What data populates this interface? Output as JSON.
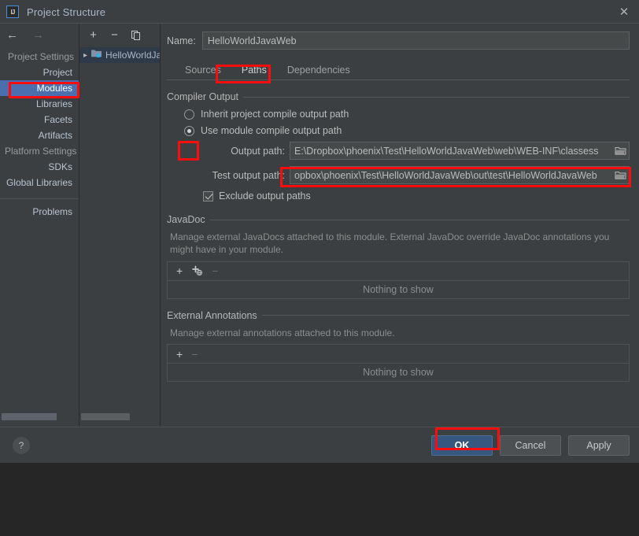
{
  "window": {
    "title": "Project Structure",
    "logo_text": "IJ",
    "close_icon": "close-icon"
  },
  "nav": {
    "back_icon": "arrow-left-icon",
    "forward_icon": "arrow-right-icon",
    "groups": [
      {
        "label": "Project Settings",
        "items": [
          {
            "label": "Project",
            "selected": false
          },
          {
            "label": "Modules",
            "selected": true
          },
          {
            "label": "Libraries",
            "selected": false
          },
          {
            "label": "Facets",
            "selected": false
          },
          {
            "label": "Artifacts",
            "selected": false
          }
        ]
      },
      {
        "label": "Platform Settings",
        "items": [
          {
            "label": "SDKs",
            "selected": false
          },
          {
            "label": "Global Libraries",
            "selected": false
          }
        ]
      }
    ],
    "problems_label": "Problems"
  },
  "tree": {
    "toolbar": {
      "add_icon": "plus-icon",
      "remove_icon": "minus-icon",
      "copy_icon": "copy-icon"
    },
    "nodes": [
      {
        "label": "HelloWorldJavaWeb",
        "expand_icon": "chevron-right-icon",
        "selected": true
      }
    ]
  },
  "main": {
    "name_label": "Name:",
    "name_value": "HelloWorldJavaWeb",
    "tabs": [
      {
        "label": "Sources",
        "active": false
      },
      {
        "label": "Paths",
        "active": true
      },
      {
        "label": "Dependencies",
        "active": false
      }
    ],
    "compiler_output": {
      "title": "Compiler Output",
      "inherit_option": "Inherit project compile output path",
      "module_option": "Use module compile output path",
      "inherit_selected": false,
      "module_selected": true,
      "output_path_label": "Output path:",
      "output_path_value": "E:\\Dropbox\\phoenix\\Test\\HelloWorldJavaWeb\\web\\WEB-INF\\classess",
      "test_output_path_label": "Test output path:",
      "test_output_path_value": "opbox\\phoenix\\Test\\HelloWorldJavaWeb\\out\\test\\HelloWorldJavaWeb",
      "exclude_label": "Exclude output paths",
      "exclude_checked": true,
      "browse_icon": "folder-icon"
    },
    "javadoc": {
      "title": "JavaDoc",
      "description": "Manage external JavaDocs attached to this module. External JavaDoc override JavaDoc annotations you might have in your module.",
      "toolbar": {
        "add_icon": "plus-icon",
        "add_url_icon": "plus-globe-icon",
        "remove_icon": "minus-icon"
      },
      "empty_text": "Nothing to show"
    },
    "external_annotations": {
      "title": "External Annotations",
      "description": "Manage external annotations attached to this module.",
      "toolbar": {
        "add_icon": "plus-icon",
        "remove_icon": "minus-icon"
      },
      "empty_text": "Nothing to show"
    }
  },
  "footer": {
    "help_label": "?",
    "ok_label": "OK",
    "cancel_label": "Cancel",
    "apply_label": "Apply"
  },
  "colors": {
    "dialog_bg": "#3c3f41",
    "accent_selected": "#4b6eaf",
    "primary_button": "#365880",
    "annotation_red": "#fb0d0d",
    "text": "#bbbbbb"
  }
}
